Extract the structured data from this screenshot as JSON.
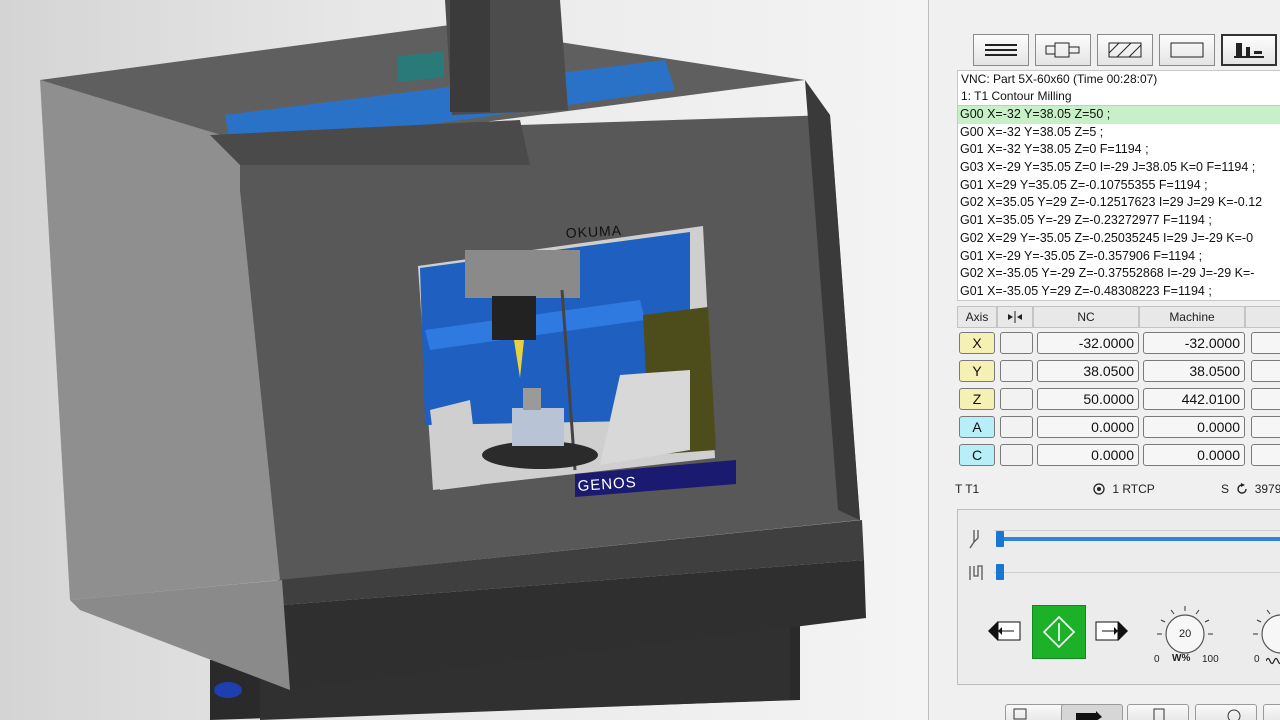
{
  "viewport": {
    "machine_brand": "OKUMA",
    "machine_model": "GENOS"
  },
  "toolbar": {
    "buttons": [
      {
        "icon": "list-icon"
      },
      {
        "icon": "spindle-icon"
      },
      {
        "icon": "hatch-icon"
      },
      {
        "icon": "rectangle-icon"
      },
      {
        "icon": "machine-icon",
        "active": true
      }
    ]
  },
  "nc": {
    "program": "VNC: Part 5X-60x60 (Time 00:28:07)",
    "operation": "1: T1 Contour Milling",
    "lines": [
      "G00 X=-32 Y=38.05 Z=50 ;",
      "G00 X=-32 Y=38.05 Z=5 ;",
      "G01 X=-32 Y=38.05 Z=0 F=1194 ;",
      "G03 X=-29 Y=35.05 Z=0 I=-29 J=38.05 K=0 F=1194 ;",
      "G01 X=29 Y=35.05 Z=-0.10755355 F=1194 ;",
      "G02 X=35.05 Y=29 Z=-0.12517623 I=29 J=29 K=-0.12",
      "G01 X=35.05 Y=-29 Z=-0.23272977 F=1194 ;",
      "G02 X=29 Y=-35.05 Z=-0.25035245 I=29 J=-29 K=-0",
      "G01 X=-29 Y=-35.05 Z=-0.357906 F=1194 ;",
      "G02 X=-35.05 Y=-29 Z=-0.37552868 I=-29 J=-29 K=-",
      "G01 X=-35.05 Y=29 Z=-0.48308223 F=1194 ;"
    ]
  },
  "axes": {
    "head_axis": "Axis",
    "head_nc": "NC",
    "head_machine": "Machine",
    "rows": [
      {
        "name": "X",
        "nc": "-32.0000",
        "machine": "-32.0000",
        "kind": "lin"
      },
      {
        "name": "Y",
        "nc": "38.0500",
        "machine": "38.0500",
        "kind": "lin"
      },
      {
        "name": "Z",
        "nc": "50.0000",
        "machine": "442.0100",
        "kind": "lin"
      },
      {
        "name": "A",
        "nc": "0.0000",
        "machine": "0.0000",
        "kind": "rot"
      },
      {
        "name": "C",
        "nc": "0.0000",
        "machine": "0.0000",
        "kind": "rot"
      }
    ]
  },
  "status": {
    "tool": "T T1",
    "rtcp": "1  RTCP",
    "spindle_label": "S",
    "spindle_value": "3979"
  },
  "controls": {
    "feed_knob_value": "20",
    "feed_min": "0",
    "feed_max": "100",
    "feed_unit": "W%",
    "knob2_min": "0",
    "slider_position": 1.0,
    "slider2_position": 0.0
  },
  "colors": {
    "accent_blue": "#1976d2",
    "start_green": "#1db12a",
    "current_line": "#c8f0c8",
    "linear_axis": "#f5f0b4",
    "rotary_axis": "#b8eef8"
  }
}
